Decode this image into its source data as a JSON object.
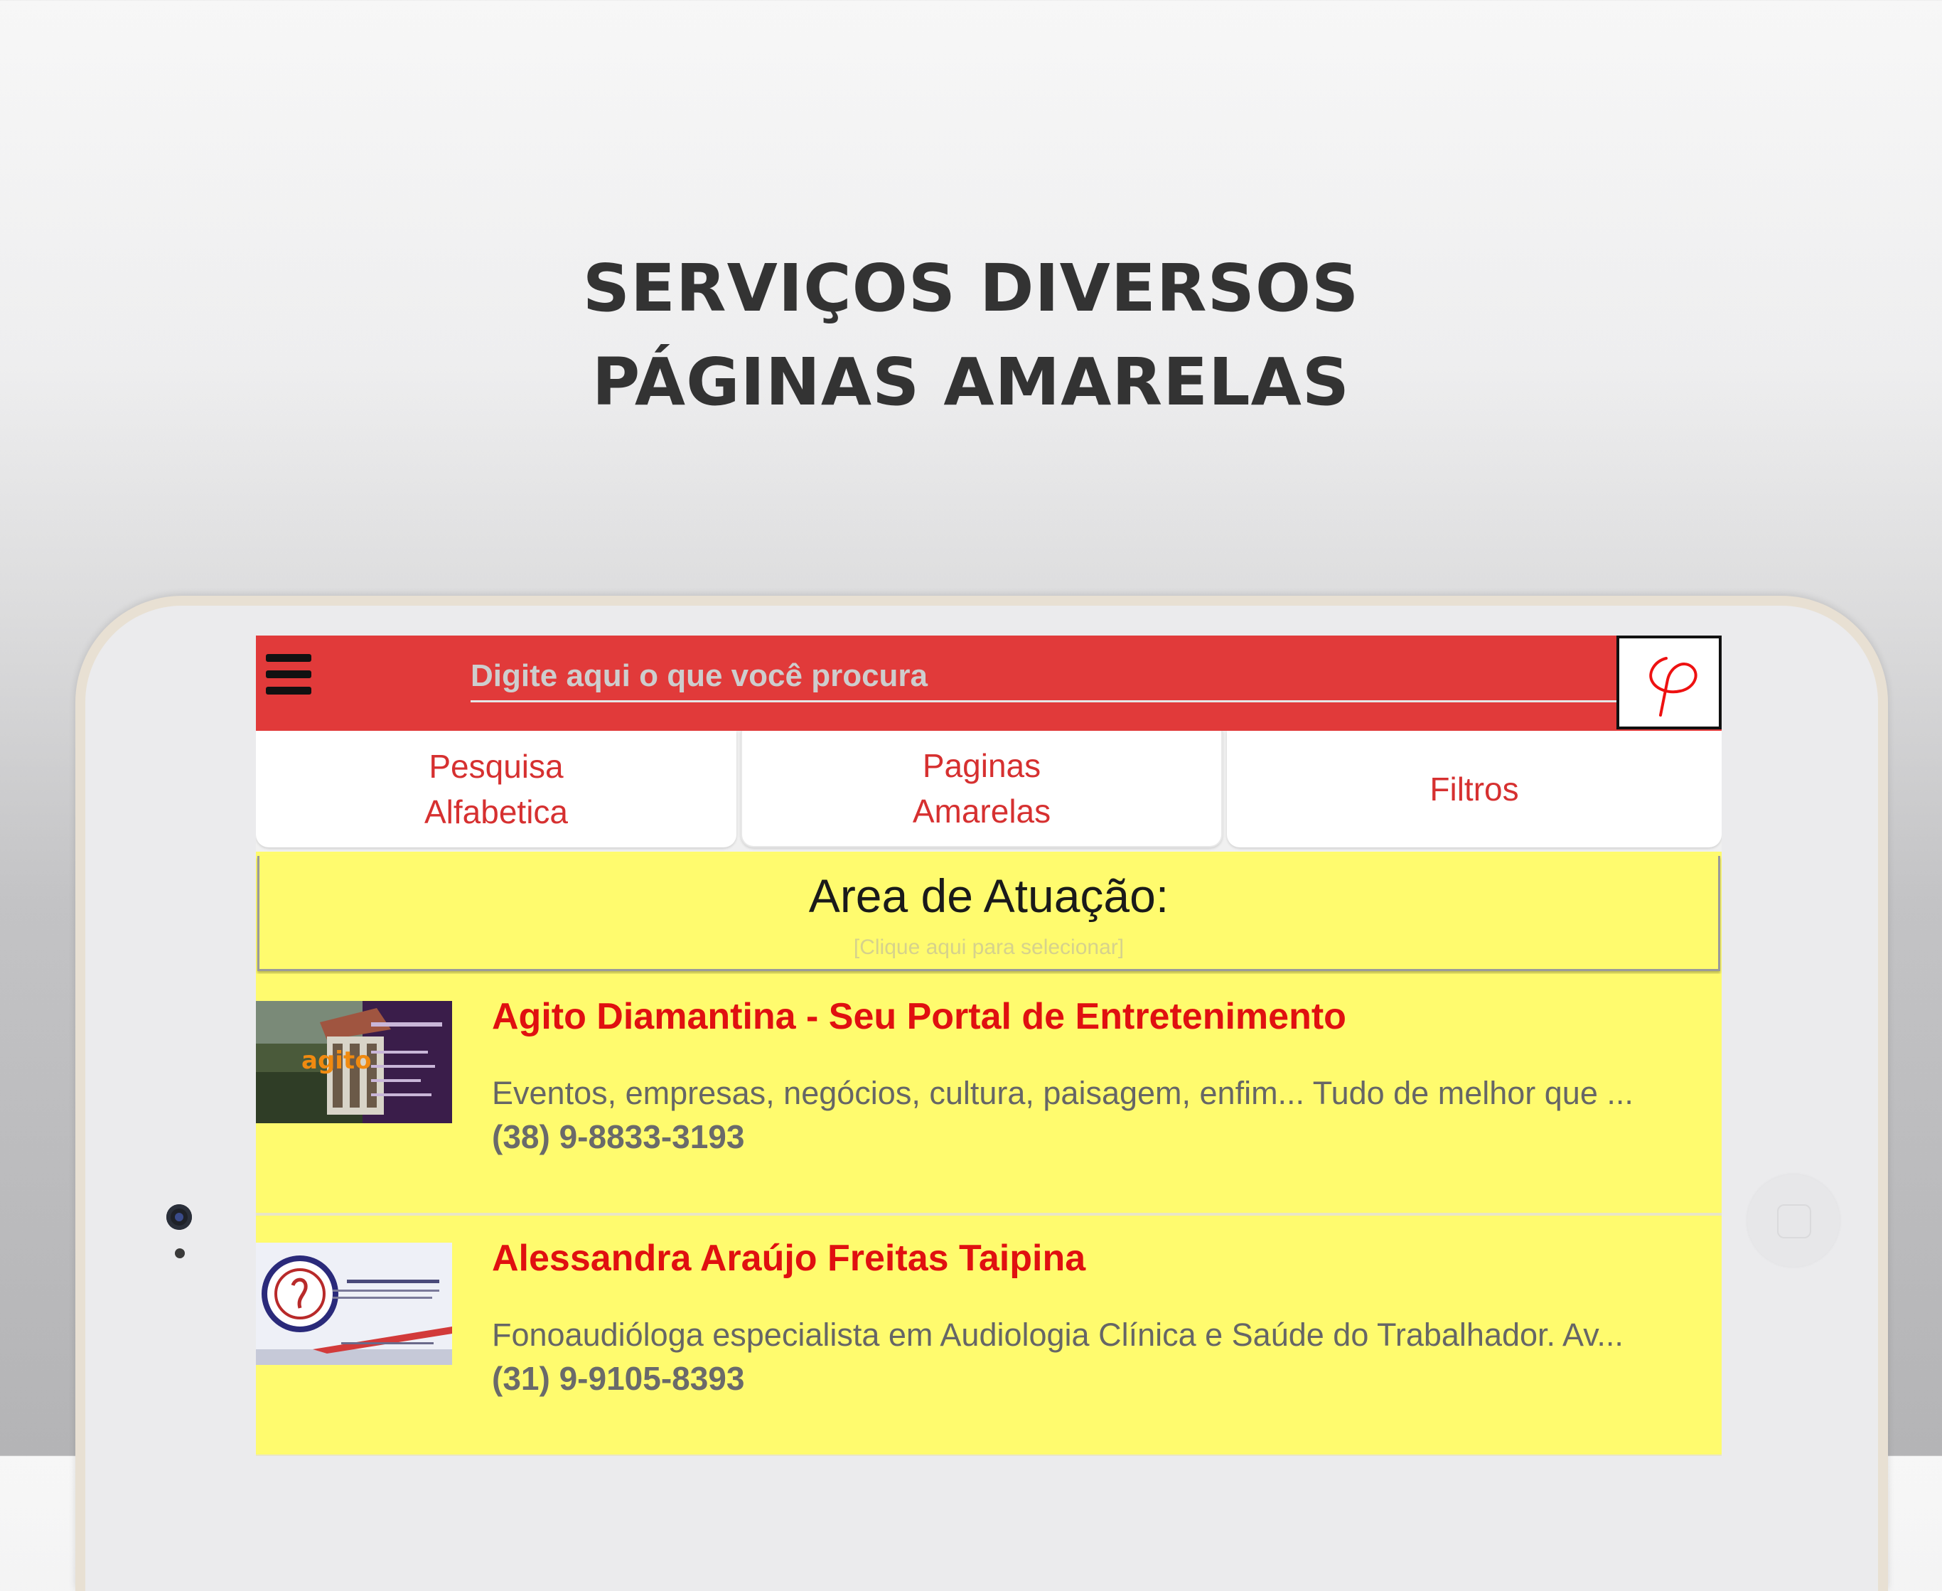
{
  "headline": {
    "line1": "SERVIÇOS DIVERSOS",
    "line2": "PÁGINAS AMARELAS"
  },
  "appbar": {
    "menu_icon": "hamburger-menu-icon",
    "search_placeholder": "Digite aqui o que você procura",
    "logo_icon": "red-p-logo-icon"
  },
  "tabs": [
    {
      "label": "Pesquisa\nAlfabetica"
    },
    {
      "label": "Paginas\nAmarelas"
    },
    {
      "label": "Filtros"
    }
  ],
  "area": {
    "title": "Area de Atuação:",
    "hint": "[Clique aqui para selecionar]"
  },
  "listings": [
    {
      "title": "Agito Diamantina - Seu Portal de Entretenimento",
      "description": "Eventos, empresas, negócios, cultura, paisagem, enfim... Tudo de melhor que ...",
      "phone": "(38) 9-8833-3193",
      "thumb_text": "agito"
    },
    {
      "title": "Alessandra Araújo Freitas Taipina",
      "description": "Fonoaudióloga especialista em Audiologia Clínica e Saúde do Trabalhador. Av...",
      "phone": "(31) 9-9105-8393"
    }
  ],
  "colors": {
    "appbar": "#e13a3a",
    "background": "#fffb6e",
    "title_red": "#e01010"
  }
}
